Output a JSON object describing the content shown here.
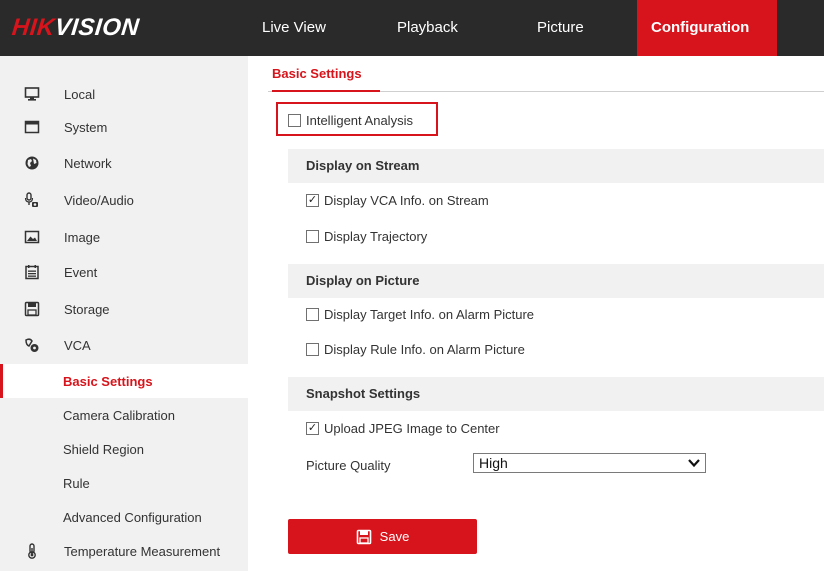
{
  "brand": {
    "logo_part1": "HIK",
    "logo_part2": "VISION"
  },
  "nav": {
    "items": [
      {
        "label": "Live View"
      },
      {
        "label": "Playback"
      },
      {
        "label": "Picture"
      },
      {
        "label": "Configuration",
        "active": true
      }
    ]
  },
  "sidebar": {
    "items": [
      {
        "label": "Local",
        "icon": "monitor-icon"
      },
      {
        "label": "System",
        "icon": "window-icon"
      },
      {
        "label": "Network",
        "icon": "globe-icon"
      },
      {
        "label": "Video/Audio",
        "icon": "microphone-camera-icon"
      },
      {
        "label": "Image",
        "icon": "image-icon"
      },
      {
        "label": "Event",
        "icon": "calendar-icon"
      },
      {
        "label": "Storage",
        "icon": "floppy-disk-icon"
      },
      {
        "label": "VCA",
        "icon": "vca-icon"
      }
    ],
    "vca_sub": [
      {
        "label": "Basic Settings",
        "active": true
      },
      {
        "label": "Camera Calibration"
      },
      {
        "label": "Shield Region"
      },
      {
        "label": "Rule"
      },
      {
        "label": "Advanced Configuration"
      }
    ],
    "last_item": {
      "label": "Temperature Measurement",
      "icon": "thermometer-icon"
    }
  },
  "content": {
    "tab": "Basic Settings",
    "intelligent_analysis": {
      "label": "Intelligent Analysis",
      "checked": false
    },
    "sections": {
      "display_on_stream": "Display on Stream",
      "display_on_picture": "Display on Picture",
      "snapshot_settings": "Snapshot Settings"
    },
    "options": {
      "display_vca_info": {
        "label": "Display VCA Info. on Stream",
        "checked": true
      },
      "display_trajectory": {
        "label": "Display Trajectory",
        "checked": false
      },
      "display_target_info": {
        "label": "Display Target Info. on Alarm Picture",
        "checked": false
      },
      "display_rule_info": {
        "label": "Display Rule Info. on Alarm Picture",
        "checked": false
      },
      "upload_jpeg": {
        "label": "Upload JPEG Image to Center",
        "checked": true
      }
    },
    "picture_quality": {
      "label": "Picture Quality",
      "value": "High"
    },
    "save_label": "Save"
  },
  "colors": {
    "accent": "#d7141b",
    "topbar": "#2a2a2a",
    "sidebar_bg": "#f1f1f1"
  }
}
